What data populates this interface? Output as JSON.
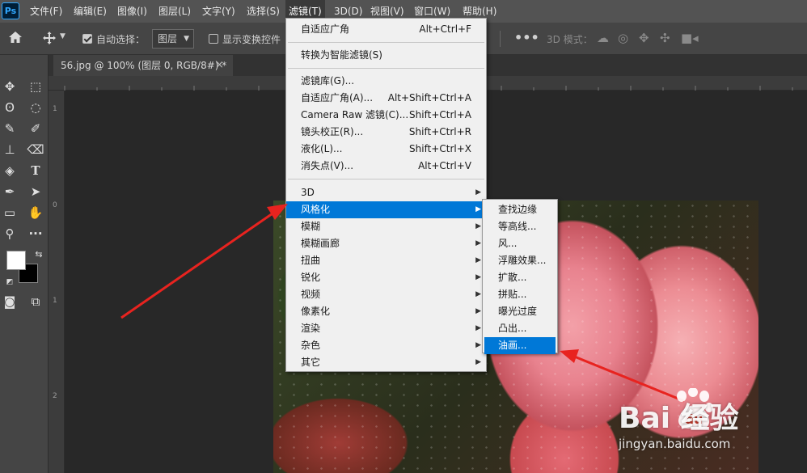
{
  "app": {
    "logo": "Ps"
  },
  "menubar": {
    "items": [
      {
        "label": "文件(F)"
      },
      {
        "label": "编辑(E)"
      },
      {
        "label": "图像(I)"
      },
      {
        "label": "图层(L)"
      },
      {
        "label": "文字(Y)"
      },
      {
        "label": "选择(S)"
      },
      {
        "label": "滤镜(T)"
      },
      {
        "label": "3D(D)"
      },
      {
        "label": "视图(V)"
      },
      {
        "label": "窗口(W)"
      },
      {
        "label": "帮助(H)"
      }
    ],
    "open_item": "滤镜(T)"
  },
  "options_bar": {
    "auto_select_label": "自动选择：",
    "auto_select_checked": true,
    "auto_select_value": "图层",
    "show_transform_label": "显示变换控件",
    "show_transform_checked": false,
    "mode_3d_label": "3D 模式：",
    "more_icon": "ellipsis-icon"
  },
  "document_tab": {
    "title": "56.jpg @ 100% (图层 0, RGB/8#) *",
    "close": "×"
  },
  "rulers": {
    "left_labels": [
      "1",
      "0",
      "1",
      "2"
    ]
  },
  "filter_menu": {
    "items": [
      {
        "label": "自适应广角",
        "shortcut": "Alt+Ctrl+F"
      },
      {
        "label": "转换为智能滤镜(S)",
        "shortcut": ""
      },
      {
        "label": "滤镜库(G)...",
        "shortcut": ""
      },
      {
        "label": "自适应广角(A)...",
        "shortcut": "Alt+Shift+Ctrl+A"
      },
      {
        "label": "Camera Raw 滤镜(C)...",
        "shortcut": "Shift+Ctrl+A"
      },
      {
        "label": "镜头校正(R)...",
        "shortcut": "Shift+Ctrl+R"
      },
      {
        "label": "液化(L)...",
        "shortcut": "Shift+Ctrl+X"
      },
      {
        "label": "消失点(V)...",
        "shortcut": "Alt+Ctrl+V"
      },
      {
        "label": "3D",
        "submenu": true
      },
      {
        "label": "风格化",
        "submenu": true,
        "highlighted": true
      },
      {
        "label": "模糊",
        "submenu": true
      },
      {
        "label": "模糊画廊",
        "submenu": true
      },
      {
        "label": "扭曲",
        "submenu": true
      },
      {
        "label": "锐化",
        "submenu": true
      },
      {
        "label": "视频",
        "submenu": true
      },
      {
        "label": "像素化",
        "submenu": true
      },
      {
        "label": "渲染",
        "submenu": true
      },
      {
        "label": "杂色",
        "submenu": true
      },
      {
        "label": "其它",
        "submenu": true
      }
    ]
  },
  "stylize_submenu": {
    "items": [
      {
        "label": "查找边缘"
      },
      {
        "label": "等高线..."
      },
      {
        "label": "风..."
      },
      {
        "label": "浮雕效果..."
      },
      {
        "label": "扩散..."
      },
      {
        "label": "拼贴..."
      },
      {
        "label": "曝光过度"
      },
      {
        "label": "凸出..."
      },
      {
        "label": "油画...",
        "highlighted": true
      }
    ]
  },
  "watermark": {
    "logo": "Bai  经验",
    "url": "jingyan.baidu.com"
  },
  "colors": {
    "highlight": "#0078d7",
    "arrow": "#e8231f",
    "menu_bg": "#f0f0f0"
  }
}
